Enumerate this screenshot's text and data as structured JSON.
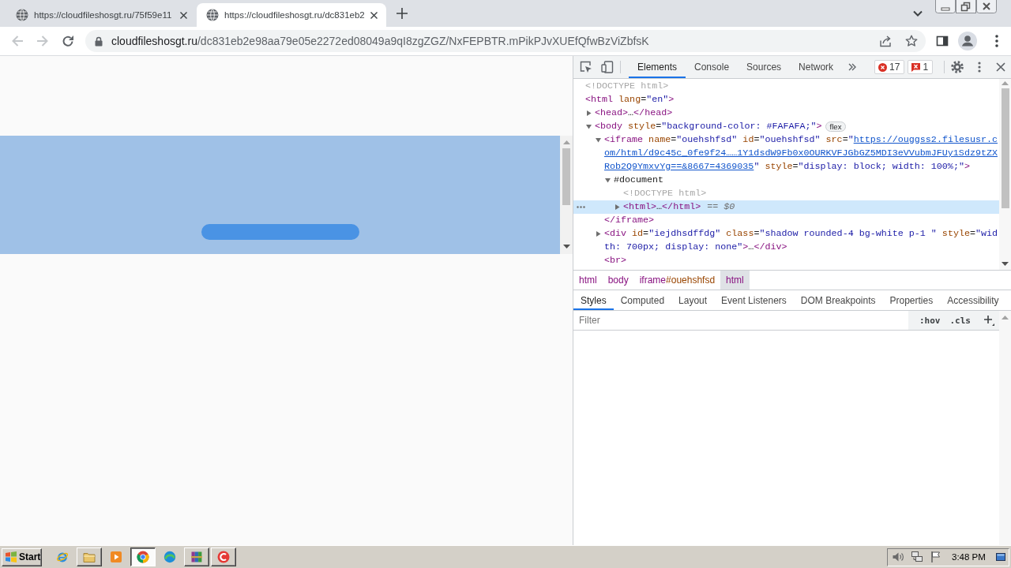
{
  "browser": {
    "tabs": [
      {
        "title": "https://cloudfileshosgt.ru/75f59e11",
        "selected": false
      },
      {
        "title": "https://cloudfileshosgt.ru/dc831eb2",
        "selected": true
      }
    ],
    "nav_buttons": [
      {
        "kind": "back",
        "disabled": true
      },
      {
        "kind": "forward",
        "disabled": true
      },
      {
        "kind": "reload",
        "disabled": false
      }
    ],
    "address_bar": {
      "host": "cloudfileshosgt.ru",
      "path": "/dc831eb2e98aa79e05e2272ed08049a9qI8zgZGZ/NxFEPBTR.mPikPJvXUEfQfwBzViZbfsK"
    }
  },
  "devtools": {
    "tabs": [
      {
        "label": "Elements",
        "selected": true
      },
      {
        "label": "Console",
        "selected": false
      },
      {
        "label": "Sources",
        "selected": false
      },
      {
        "label": "Network",
        "selected": false
      }
    ],
    "error_count": "17",
    "issue_count": "1",
    "dom_tree": [
      {
        "selected": false,
        "tokens": [
          {
            "kind": "doctype",
            "text": "<!DOCTYPE html>"
          }
        ]
      },
      {
        "selected": false,
        "tokens": [
          {
            "kind": "tag",
            "text": "<html"
          },
          {
            "kind": "attr",
            "text": " lang"
          },
          {
            "kind": "punct",
            "text": "="
          },
          {
            "kind": "value",
            "text": "\"en\""
          },
          {
            "kind": "tag",
            "text": ">"
          }
        ],
        "children": [
          {
            "selected": false,
            "expanded": false,
            "tokens": [
              {
                "kind": "tag",
                "text": "<head>"
              },
              {
                "kind": "punct",
                "text": "…"
              },
              {
                "kind": "tag",
                "text": "</head>"
              }
            ]
          },
          {
            "selected": false,
            "expanded": true,
            "badge": "flex",
            "tokens": [
              {
                "kind": "tag",
                "text": "<body"
              },
              {
                "kind": "attr",
                "text": " style"
              },
              {
                "kind": "punct",
                "text": "="
              },
              {
                "kind": "value",
                "text": "\"background-color: #FAFAFA;\""
              },
              {
                "kind": "tag",
                "text": ">"
              }
            ],
            "children": [
              {
                "selected": false,
                "expanded": true,
                "closing_tag": "</iframe>",
                "tokens": [
                  {
                    "kind": "tag",
                    "text": "<iframe"
                  },
                  {
                    "kind": "attr",
                    "text": " name"
                  },
                  {
                    "kind": "punct",
                    "text": "="
                  },
                  {
                    "kind": "value",
                    "text": "\"ouehshfsd\""
                  },
                  {
                    "kind": "attr",
                    "text": " id"
                  },
                  {
                    "kind": "punct",
                    "text": "="
                  },
                  {
                    "kind": "value",
                    "text": "\"ouehshfsd\""
                  },
                  {
                    "kind": "attr",
                    "text": " src"
                  },
                  {
                    "kind": "punct",
                    "text": "="
                  },
                  {
                    "kind": "value",
                    "text": "\""
                  },
                  {
                    "kind": "link",
                    "text": "https://ouggss2.filesusr.com/html/d9c45c_0fe9f24……1Y1dsdW9Fb0x0OURKVFJGbGZ5MDI3eVVubmJFUy1Sdz9tZXRob2Q9YmxvYg==&8667=4369035"
                  },
                  {
                    "kind": "value",
                    "text": "\""
                  },
                  {
                    "kind": "attr",
                    "text": " style"
                  },
                  {
                    "kind": "punct",
                    "text": "="
                  },
                  {
                    "kind": "value",
                    "text": "\"display: block; width: 100%;\""
                  },
                  {
                    "kind": "tag",
                    "text": ">"
                  }
                ],
                "children": [
                  {
                    "selected": false,
                    "expanded": true,
                    "tokens": [
                      {
                        "kind": "punct",
                        "text": "#document"
                      }
                    ],
                    "children": [
                      {
                        "selected": false,
                        "tokens": [
                          {
                            "kind": "doctype",
                            "text": "<!DOCTYPE html>"
                          }
                        ]
                      },
                      {
                        "selected": true,
                        "expanded": false,
                        "reference": "== $0",
                        "tokens": [
                          {
                            "kind": "tag",
                            "text": "<html>"
                          },
                          {
                            "kind": "punct",
                            "text": "…"
                          },
                          {
                            "kind": "tag",
                            "text": "</html>"
                          }
                        ]
                      }
                    ]
                  }
                ]
              },
              {
                "selected": false,
                "expanded": false,
                "tokens": [
                  {
                    "kind": "tag",
                    "text": "<div"
                  },
                  {
                    "kind": "attr",
                    "text": " id"
                  },
                  {
                    "kind": "punct",
                    "text": "="
                  },
                  {
                    "kind": "value",
                    "text": "\"iejdhsdffdg\""
                  },
                  {
                    "kind": "attr",
                    "text": " class"
                  },
                  {
                    "kind": "punct",
                    "text": "="
                  },
                  {
                    "kind": "value",
                    "text": "\"shadow rounded-4 bg-white p-1 \""
                  },
                  {
                    "kind": "attr",
                    "text": " style"
                  },
                  {
                    "kind": "punct",
                    "text": "="
                  },
                  {
                    "kind": "value",
                    "text": "\"width: 700px; display: none\""
                  },
                  {
                    "kind": "tag",
                    "text": ">"
                  },
                  {
                    "kind": "punct",
                    "text": "…"
                  },
                  {
                    "kind": "tag",
                    "text": "</div>"
                  }
                ]
              },
              {
                "selected": false,
                "tokens": [
                  {
                    "kind": "tag",
                    "text": "<br>"
                  }
                ]
              }
            ]
          }
        ]
      }
    ],
    "breadcrumbs": [
      {
        "tag": "html",
        "selected": false
      },
      {
        "tag": "body",
        "selected": false
      },
      {
        "tag": "iframe",
        "id": "#ouehshfsd",
        "selected": false
      },
      {
        "tag": "html",
        "selected": true
      }
    ],
    "panel_tabs": [
      {
        "label": "Styles",
        "selected": true
      },
      {
        "label": "Computed",
        "selected": false
      },
      {
        "label": "Layout",
        "selected": false
      },
      {
        "label": "Event Listeners",
        "selected": false
      },
      {
        "label": "DOM Breakpoints",
        "selected": false
      },
      {
        "label": "Properties",
        "selected": false
      },
      {
        "label": "Accessibility",
        "selected": false
      }
    ],
    "filter": {
      "placeholder": "Filter"
    },
    "filter_buttons": [
      ":hov",
      ".cls"
    ]
  },
  "taskbar": {
    "start_label": "Start",
    "items": [
      {
        "kind": "ie",
        "selected": false
      },
      {
        "kind": "folder",
        "selected": false
      },
      {
        "kind": "player",
        "selected": false
      },
      {
        "kind": "chrome",
        "selected": true
      },
      {
        "kind": "edge",
        "selected": false
      },
      {
        "kind": "archive",
        "selected": false
      },
      {
        "kind": "recorder",
        "selected": false
      }
    ],
    "clock": "3:48 PM"
  }
}
